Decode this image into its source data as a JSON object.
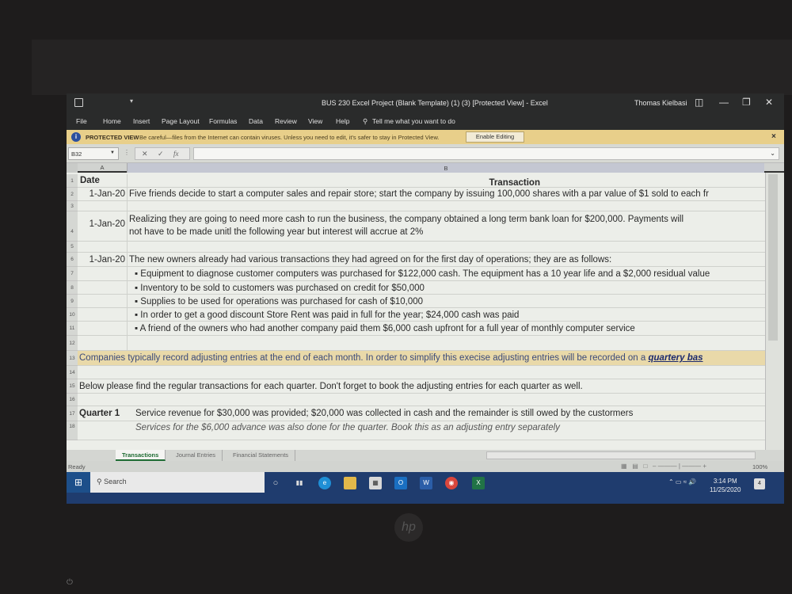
{
  "window": {
    "title": "BUS 230 Excel Project (Blank Template) (1) (3) [Protected View] - Excel",
    "user": "Thomas Kielbasi",
    "controls": [
      "ribbon-display",
      "minimize",
      "restore",
      "close"
    ]
  },
  "menu": [
    "File",
    "Home",
    "Insert",
    "Page Layout",
    "Formulas",
    "Data",
    "Review",
    "View",
    "Help"
  ],
  "tell_me": "Tell me what you want to do",
  "protected_view": {
    "label": "PROTECTED VIEW",
    "message": "Be careful—files from the Internet can contain viruses. Unless you need to edit, it's safer to stay in Protected View.",
    "button": "Enable Editing"
  },
  "formula_bar": {
    "name_box": "B32",
    "cancel": "✕",
    "enter": "✓",
    "fx": "fx",
    "value": ""
  },
  "columns": [
    "A",
    "B"
  ],
  "rows": [
    {
      "n": "1",
      "a": "Date",
      "b": "Transaction"
    },
    {
      "n": "2",
      "a": "1-Jan-20",
      "b": "Five friends decide to start a computer sales and repair store; start the company by issuing 100,000 shares with a par value of $1 sold to each fr"
    },
    {
      "n": "3",
      "a": "",
      "b": ""
    },
    {
      "n": "4",
      "a": "1-Jan-20",
      "b": "Realizing they are going to need more cash to run the business, the company obtained a long term bank loan for $200,000. Payments will",
      "b2": "not have to be made unitl the following year but interest will accrue at 2%"
    },
    {
      "n": "5",
      "a": "",
      "b": ""
    },
    {
      "n": "6",
      "a": "1-Jan-20",
      "b": "The new owners already had various transactions they had agreed on for the first day of operations; they are as follows:"
    },
    {
      "n": "7",
      "a": "",
      "b": "▪ Equipment to diagnose customer computers was purchased for $122,000 cash. The equipment has a 10 year life and a $2,000 residual value"
    },
    {
      "n": "8",
      "a": "",
      "b": "▪ Inventory to be sold to customers was purchased on credit for $50,000"
    },
    {
      "n": "9",
      "a": "",
      "b": "▪ Supplies to be used for operations was purchased for cash of $10,000"
    },
    {
      "n": "10",
      "a": "",
      "b": "▪ In order to get a good discount Store Rent was paid in full for the year; $24,000 cash was paid"
    },
    {
      "n": "11",
      "a": "",
      "b": "▪ A friend of the owners who had another company paid them $6,000 cash upfront for a full year of monthly computer service"
    },
    {
      "n": "12",
      "a": "",
      "b": ""
    },
    {
      "n": "13",
      "a": "",
      "b": "Companies typically record adjusting entries at the end of each month. In order to simplify this execise adjusting entries will be recorded on a ",
      "link": "quartery bas"
    },
    {
      "n": "14",
      "a": "",
      "b": ""
    },
    {
      "n": "15",
      "a": "",
      "b": "Below please find the regular transactions for each quarter. Don't forget to book the adjusting entries for each quarter as well."
    },
    {
      "n": "16",
      "a": "",
      "b": ""
    },
    {
      "n": "17",
      "a": "Quarter 1",
      "b": "Service revenue for $30,000 was provided; $20,000 was collected in cash and the remainder is still owed by the custormers"
    },
    {
      "n": "18",
      "a": "",
      "b": "Services for the $6,000 advance was also done for the quarter. Book this as an adjusting entry separately"
    }
  ],
  "sheet_tabs": [
    {
      "label": "Transactions",
      "active": true
    },
    {
      "label": "Journal Entries",
      "active": false
    },
    {
      "label": "Financial Statements",
      "active": false
    }
  ],
  "status": {
    "mode": "Ready",
    "zoom": "100%"
  },
  "taskbar": {
    "search_placeholder": "Search",
    "apps": [
      "Cortana",
      "Task View",
      "Edge",
      "File Explorer",
      "Store",
      "Outlook",
      "Word",
      "Chrome",
      "Excel"
    ],
    "time": "3:14 PM",
    "date": "11/25/2020",
    "notifications": "4"
  }
}
